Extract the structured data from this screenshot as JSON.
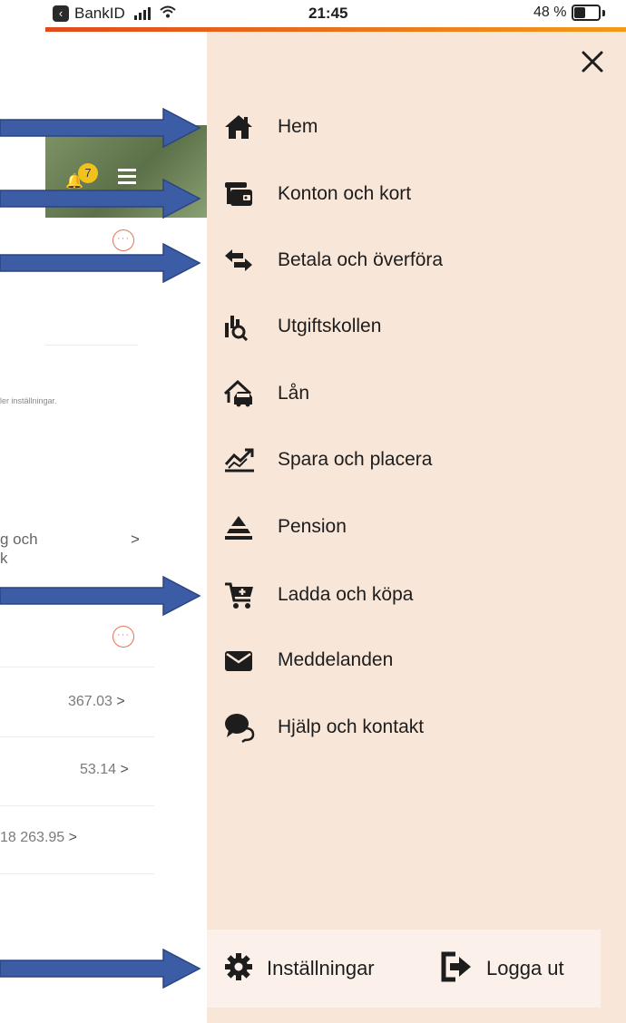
{
  "status_bar": {
    "carrier": "BankID",
    "time": "21:45",
    "battery": "48 %",
    "battery_level": 0.48
  },
  "background_page": {
    "badge_count": "7",
    "note": "ler inställningar.",
    "row_partial_line1": "g och",
    "row_partial_line2": "k",
    "values": [
      "367.03",
      "53.14",
      "18 263.95"
    ],
    "chevron": ">"
  },
  "drawer": {
    "close_icon": "close-icon",
    "items": [
      {
        "label": "Hem",
        "icon": "home-icon"
      },
      {
        "label": "Konton och kort",
        "icon": "wallet-icon"
      },
      {
        "label": "Betala och överföra",
        "icon": "transfer-arrows-icon"
      },
      {
        "label": "Utgiftskollen",
        "icon": "spending-analysis-icon"
      },
      {
        "label": "Lån",
        "icon": "house-car-icon"
      },
      {
        "label": "Spara och placera",
        "icon": "trend-chart-icon"
      },
      {
        "label": "Pension",
        "icon": "pyramid-icon"
      },
      {
        "label": "Ladda och köpa",
        "icon": "shopping-cart-icon"
      },
      {
        "label": "Meddelanden",
        "icon": "envelope-icon"
      },
      {
        "label": "Hjälp och kontakt",
        "icon": "chat-bubbles-icon"
      }
    ],
    "footer": {
      "settings_label": "Inställningar",
      "logout_label": "Logga ut"
    }
  },
  "colors": {
    "drawer_bg": "#f8e6d9",
    "arrow_blue": "#3c5da6",
    "accent_orange": "#e24a1d",
    "text_dark": "#1d1d1d"
  }
}
